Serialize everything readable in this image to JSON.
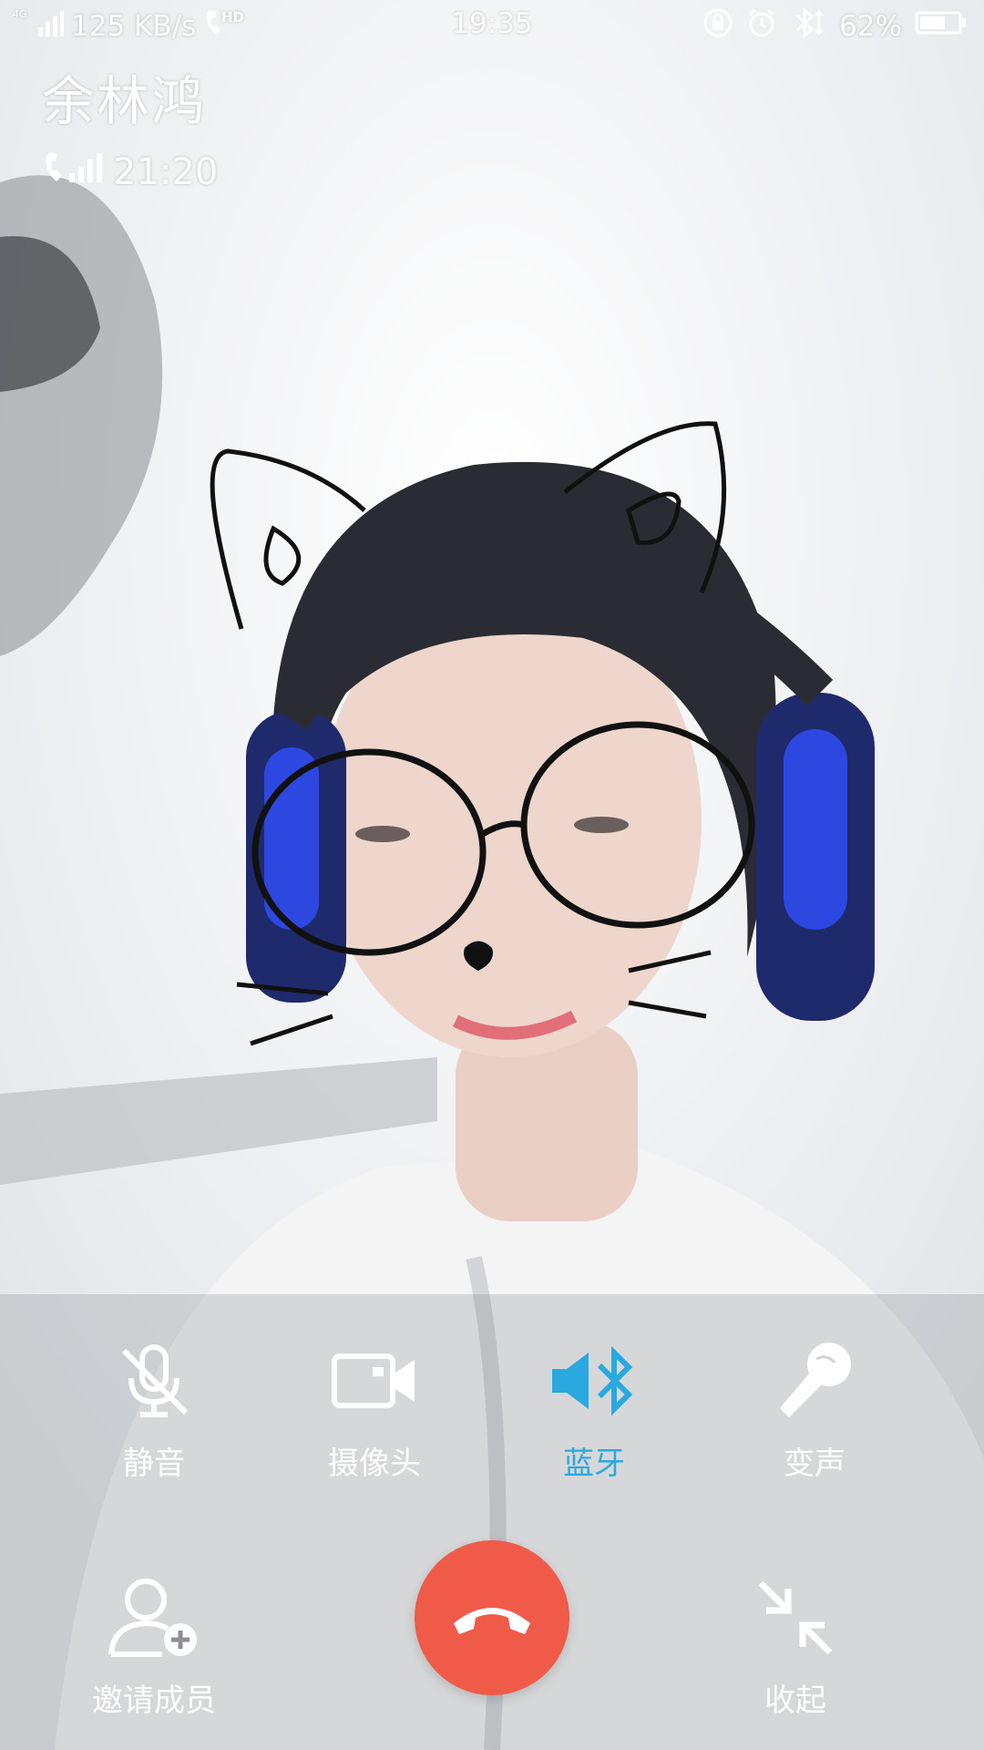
{
  "status_bar": {
    "network": "4G",
    "speed": "125 KB/s",
    "hd": "HD",
    "time": "19:35",
    "battery": "62%",
    "icons": [
      "signal-icon",
      "hd-call-icon",
      "lock-rotation-icon",
      "alarm-icon",
      "bluetooth-icon",
      "battery-icon"
    ]
  },
  "call": {
    "caller_name": "余林鸿",
    "duration": "21:20"
  },
  "controls": {
    "mute": {
      "label": "静音",
      "icon": "mic-off-icon"
    },
    "camera": {
      "label": "摄像头",
      "icon": "video-camera-icon"
    },
    "bluetooth": {
      "label": "蓝牙",
      "icon": "bluetooth-speaker-icon",
      "active": true
    },
    "voice_changer": {
      "label": "变声",
      "icon": "microphone-icon"
    },
    "invite": {
      "label": "邀请成员",
      "icon": "add-user-icon"
    },
    "hangup": {
      "icon": "hang-up-icon"
    },
    "minimize": {
      "label": "收起",
      "icon": "collapse-icon"
    }
  },
  "colors": {
    "accent": "#2aa8e0",
    "hangup": "#f05a48"
  }
}
